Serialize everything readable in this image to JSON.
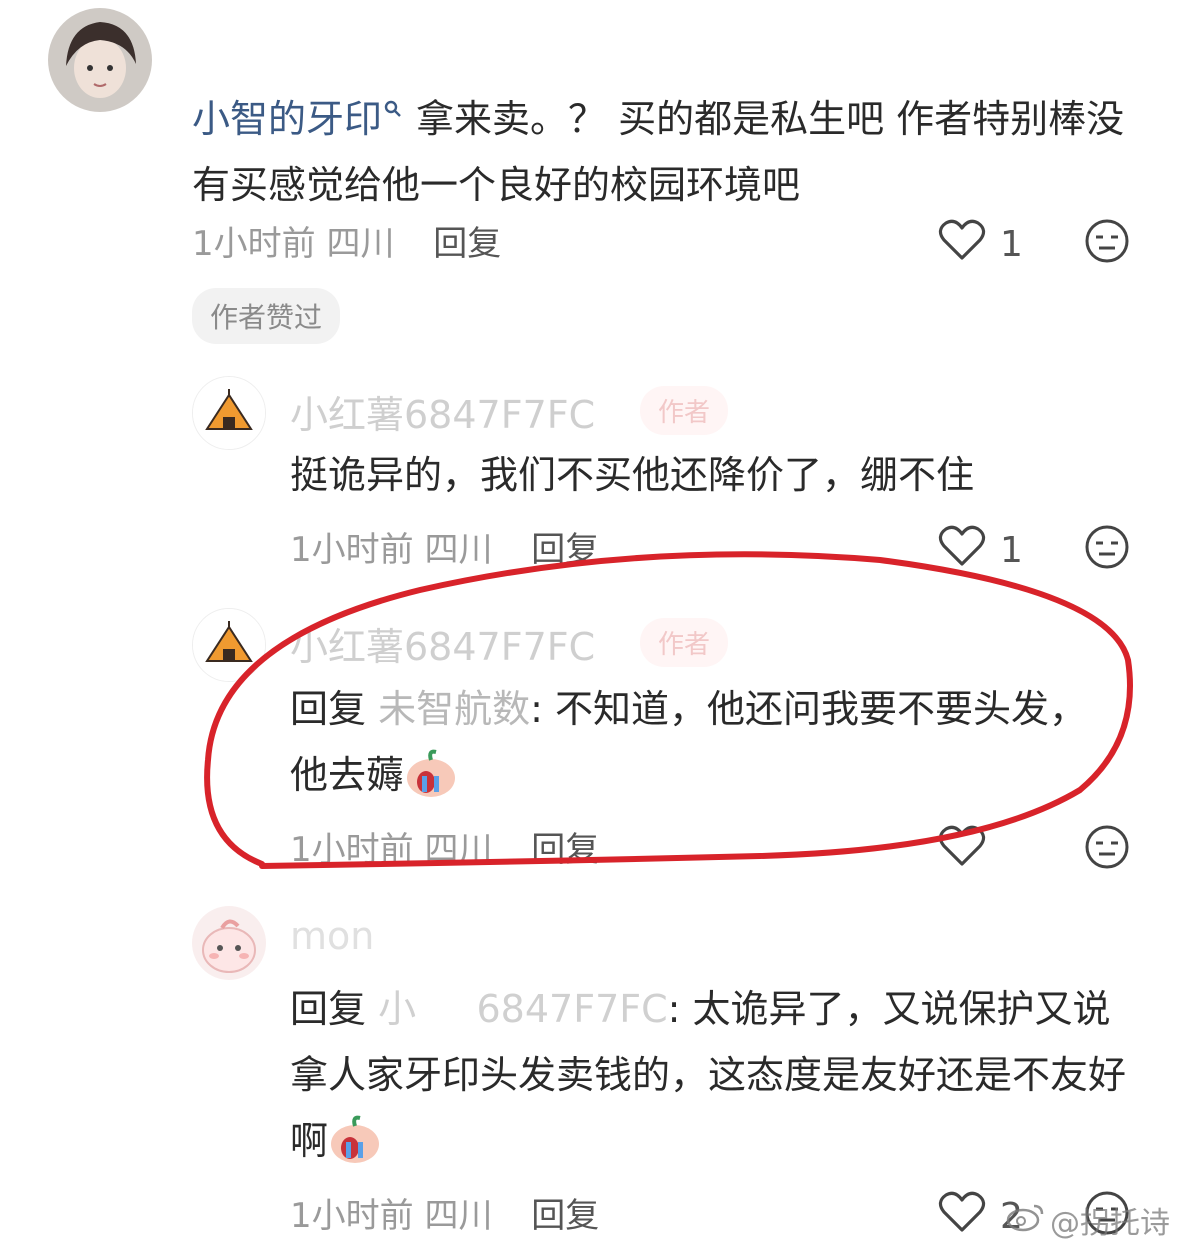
{
  "comment": {
    "username": "小智的牙印",
    "search_icon": "magnifier-icon",
    "text": "拿来卖。？ 买的都是私生吧  作者特别棒没有买感觉给他一个良好的校园环境吧",
    "time": "1小时前",
    "location": "四川",
    "reply_label": "回复",
    "likes": "1",
    "author_liked_badge": "作者赞过"
  },
  "replies": [
    {
      "username": "小红薯6847F7FC",
      "author_badge": "作者",
      "text": "挺诡异的，我们不买他还降价了，绷不住",
      "time": "1小时前",
      "location": "四川",
      "reply_label": "回复",
      "likes": "1"
    },
    {
      "username": "小红薯6847F7FC",
      "author_badge": "作者",
      "reply_prefix": "回复",
      "mention": "未智航数",
      "text": ": 不知道，他还问我要不要头发，他去薅",
      "time": "1小时前",
      "location": "四川",
      "reply_label": "回复",
      "likes": ""
    },
    {
      "username": "mon",
      "reply_prefix": "回复",
      "mention": "小     6847F7FC",
      "text": ": 太诡异了，又说保护又说拿人家牙印头发卖钱的，这态度是友好还是不友好啊",
      "time": "1小时前",
      "location": "四川",
      "reply_label": "回复",
      "likes": "2"
    }
  ],
  "watermark": "@拐托诗",
  "colors": {
    "annotation_red": "#d8232a",
    "badge_bg": "#f2f2f2",
    "author_badge_text": "#f2c8c8"
  }
}
